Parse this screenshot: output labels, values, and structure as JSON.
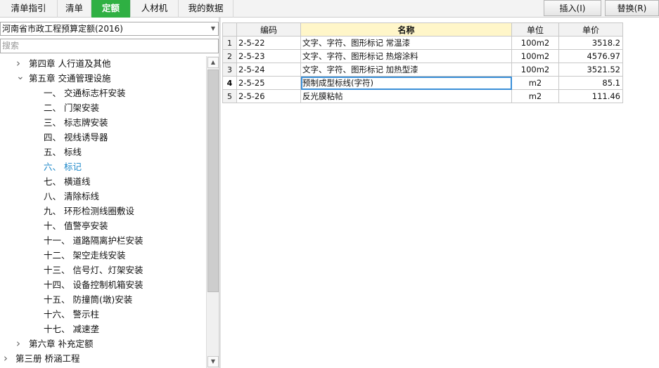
{
  "tabs": [
    {
      "label": "清单指引",
      "active": false
    },
    {
      "label": "清单",
      "active": false
    },
    {
      "label": "定额",
      "active": true
    },
    {
      "label": "人材机",
      "active": false
    },
    {
      "label": "我的数据",
      "active": false
    }
  ],
  "buttons": {
    "insert": "插入(I)",
    "replace": "替换(R)"
  },
  "library": {
    "selected": "河南省市政工程预算定额(2016)"
  },
  "search": {
    "placeholder": "搜索"
  },
  "tree": [
    {
      "label": "第四章  人行道及其他",
      "level": 1,
      "expander": "collapsed"
    },
    {
      "label": "第五章  交通管理设施",
      "level": 1,
      "expander": "expanded"
    },
    {
      "label": "一、  交通标志杆安装",
      "level": 2
    },
    {
      "label": "二、  门架安装",
      "level": 2
    },
    {
      "label": "三、  标志牌安装",
      "level": 2
    },
    {
      "label": "四、  视线诱导器",
      "level": 2
    },
    {
      "label": "五、  标线",
      "level": 2
    },
    {
      "label": "六、  标记",
      "level": 2,
      "selected": true
    },
    {
      "label": "七、  横道线",
      "level": 2
    },
    {
      "label": "八、  清除标线",
      "level": 2
    },
    {
      "label": "九、  环形检测线圈敷设",
      "level": 2
    },
    {
      "label": "十、  值警亭安装",
      "level": 2
    },
    {
      "label": "十一、  道路隔离护栏安装",
      "level": 2
    },
    {
      "label": "十二、  架空走线安装",
      "level": 2
    },
    {
      "label": "十三、  信号灯、灯架安装",
      "level": 2
    },
    {
      "label": "十四、  设备控制机箱安装",
      "level": 2
    },
    {
      "label": "十五、  防撞筒(墩)安装",
      "level": 2
    },
    {
      "label": "十六、  警示柱",
      "level": 2
    },
    {
      "label": "十七、  减速垄",
      "level": 2
    },
    {
      "label": "第六章  补充定额",
      "level": 1,
      "expander": "collapsed"
    },
    {
      "label": "第三册  桥涵工程",
      "level": 0,
      "expander": "collapsed"
    }
  ],
  "grid": {
    "columns": {
      "code": "编码",
      "name": "名称",
      "unit": "单位",
      "price": "单价"
    },
    "rows": [
      {
        "no": "1",
        "code": "2-5-22",
        "name": "文字、字符、图形标记 常温漆",
        "unit": "100m2",
        "price": "3518.2"
      },
      {
        "no": "2",
        "code": "2-5-23",
        "name": "文字、字符、图形标记 热熔涂料",
        "unit": "100m2",
        "price": "4576.97"
      },
      {
        "no": "3",
        "code": "2-5-24",
        "name": "文字、字符、图形标记 加热型漆",
        "unit": "100m2",
        "price": "3521.52"
      },
      {
        "no": "4",
        "code": "2-5-25",
        "name": "预制成型标线(字符)",
        "unit": "m2",
        "price": "85.1",
        "current": true
      },
      {
        "no": "5",
        "code": "2-5-26",
        "name": "反光膜粘帖",
        "unit": "m2",
        "price": "111.46"
      }
    ]
  },
  "colors": {
    "accent": "#2fb043",
    "selected_text": "#1a86c8",
    "header_highlight": "#fff6c9"
  },
  "icons": {
    "expand": "chevron-right-icon",
    "collapse": "chevron-down-icon",
    "scroll_up": "triangle-up-icon",
    "scroll_down": "triangle-down-icon",
    "dropdown": "triangle-down-icon"
  }
}
